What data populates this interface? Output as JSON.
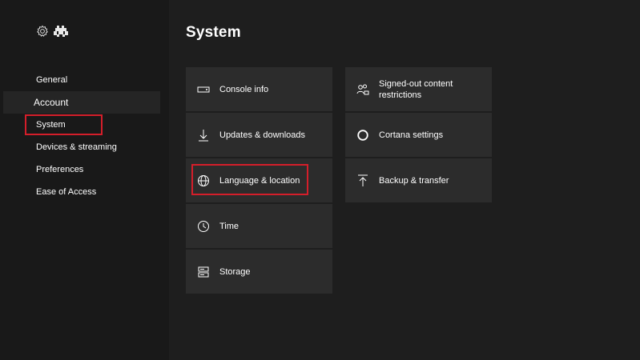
{
  "page": {
    "title": "System"
  },
  "sidebar": {
    "items": [
      {
        "label": "General"
      },
      {
        "label": "Account"
      },
      {
        "label": "System"
      },
      {
        "label": "Devices & streaming"
      },
      {
        "label": "Preferences"
      },
      {
        "label": "Ease of Access"
      }
    ]
  },
  "tiles": {
    "col1": [
      {
        "label": "Console info",
        "icon": "console-icon"
      },
      {
        "label": "Updates & downloads",
        "icon": "download-icon"
      },
      {
        "label": "Language & location",
        "icon": "globe-icon"
      },
      {
        "label": "Time",
        "icon": "clock-icon"
      },
      {
        "label": "Storage",
        "icon": "storage-icon"
      }
    ],
    "col2": [
      {
        "label": "Signed-out content restrictions",
        "icon": "users-lock-icon"
      },
      {
        "label": "Cortana settings",
        "icon": "cortana-icon"
      },
      {
        "label": "Backup & transfer",
        "icon": "upload-icon"
      }
    ]
  },
  "colors": {
    "highlight": "#d41e2a",
    "tile": "#2c2c2c",
    "background": "#1e1e1e"
  }
}
